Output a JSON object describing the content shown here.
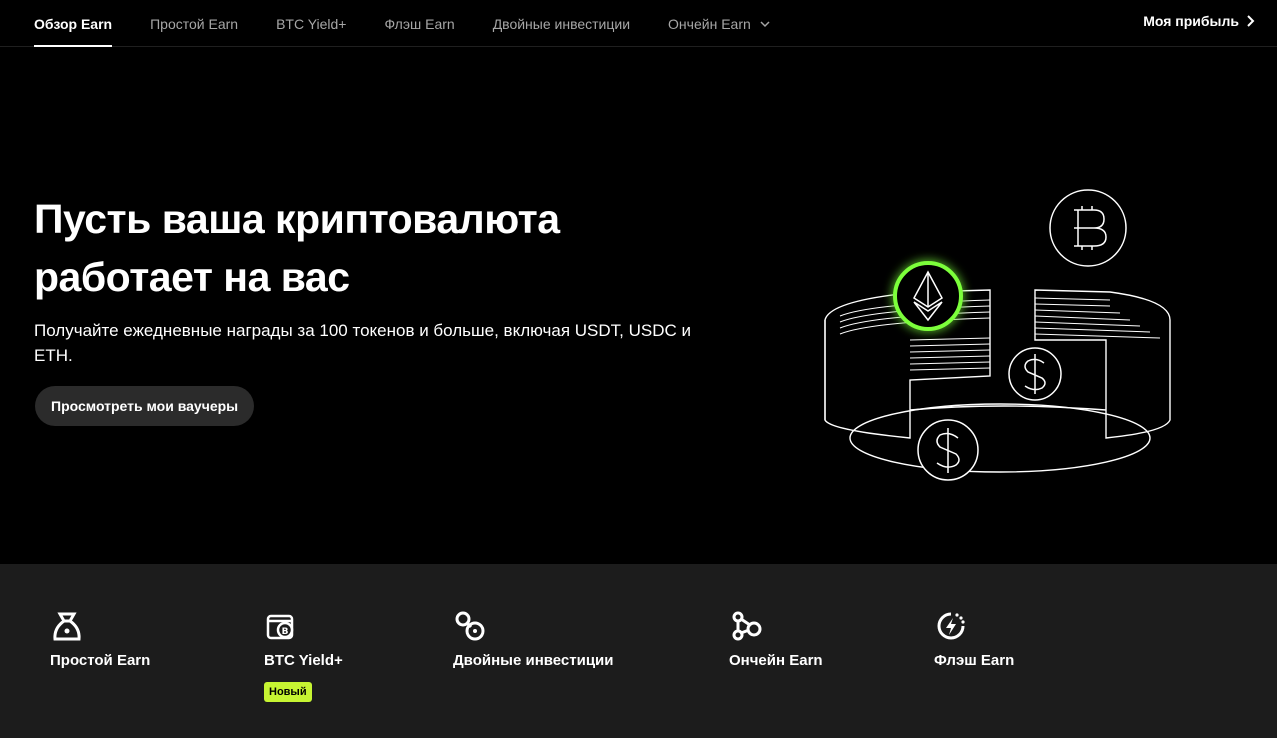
{
  "nav": {
    "tabs": [
      {
        "label": "Обзор Earn"
      },
      {
        "label": "Простой Earn"
      },
      {
        "label": "BTC Yield+"
      },
      {
        "label": "Флэш Earn"
      },
      {
        "label": "Двойные инвестиции"
      },
      {
        "label": "Ончейн Earn"
      }
    ],
    "profit_label": "Моя прибыль"
  },
  "hero": {
    "title_line1": "Пусть ваша криптовалюта",
    "title_line2": "работает на вас",
    "subtitle": "Получайте ежедневные награды за 100 токенов и больше, включая USDT, USDC и ETH.",
    "button_label": "Просмотреть мои ваучеры"
  },
  "products": [
    {
      "label": "Простой Earn",
      "icon": "money-bag-icon"
    },
    {
      "label": "BTC Yield+",
      "icon": "btc-wallet-icon",
      "badge": "Новый"
    },
    {
      "label": "Двойные инвестиции",
      "icon": "dual-coins-icon"
    },
    {
      "label": "Ончейн Earn",
      "icon": "chain-nodes-icon"
    },
    {
      "label": "Флэш Earn",
      "icon": "lightning-clock-icon"
    }
  ],
  "colors": {
    "accent": "#c6f432",
    "glow": "#7cff3a",
    "panel": "#1c1c1c"
  }
}
